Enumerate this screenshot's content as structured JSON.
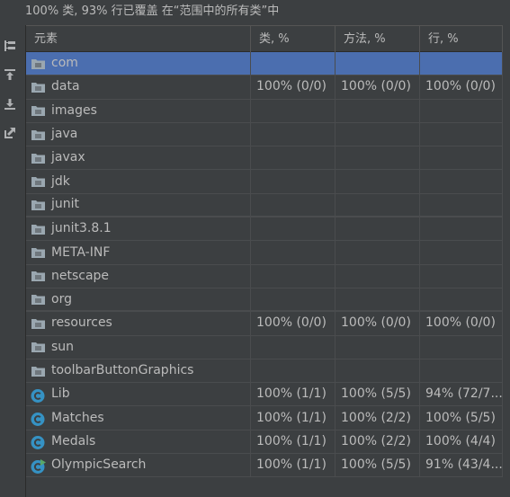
{
  "header": {
    "summary": "100% 类, 93% 行已覆盖 在“范围中的所有类”中"
  },
  "toolbar": {
    "buttons": [
      {
        "icon": "up-arrow-icon",
        "enabled": false
      },
      {
        "icon": "flatten-packages-icon",
        "enabled": true
      },
      {
        "icon": "import-icon",
        "enabled": true
      },
      {
        "icon": "export-icon",
        "enabled": true
      },
      {
        "icon": "generate-report-icon",
        "enabled": true
      }
    ]
  },
  "table": {
    "columns": [
      "元素",
      "类, %",
      "方法, %",
      "行, %"
    ],
    "rows": [
      {
        "icon": "package-icon",
        "name": "com",
        "cls": "",
        "method": "",
        "line": "",
        "selected": true
      },
      {
        "icon": "package-icon",
        "name": "data",
        "cls": "100% (0/0)",
        "method": "100% (0/0)",
        "line": "100% (0/0)"
      },
      {
        "icon": "package-icon",
        "name": "images",
        "cls": "",
        "method": "",
        "line": ""
      },
      {
        "icon": "package-icon",
        "name": "java",
        "cls": "",
        "method": "",
        "line": ""
      },
      {
        "icon": "package-icon",
        "name": "javax",
        "cls": "",
        "method": "",
        "line": ""
      },
      {
        "icon": "package-icon",
        "name": "jdk",
        "cls": "",
        "method": "",
        "line": ""
      },
      {
        "icon": "package-icon",
        "name": "junit",
        "cls": "",
        "method": "",
        "line": ""
      },
      {
        "icon": "package-icon",
        "name": "junit3.8.1",
        "cls": "",
        "method": "",
        "line": ""
      },
      {
        "icon": "package-icon",
        "name": "META-INF",
        "cls": "",
        "method": "",
        "line": ""
      },
      {
        "icon": "package-icon",
        "name": "netscape",
        "cls": "",
        "method": "",
        "line": ""
      },
      {
        "icon": "package-icon",
        "name": "org",
        "cls": "",
        "method": "",
        "line": ""
      },
      {
        "icon": "package-icon",
        "name": "resources",
        "cls": "100% (0/0)",
        "method": "100% (0/0)",
        "line": "100% (0/0)"
      },
      {
        "icon": "package-icon",
        "name": "sun",
        "cls": "",
        "method": "",
        "line": ""
      },
      {
        "icon": "package-icon",
        "name": "toolbarButtonGraphics",
        "cls": "",
        "method": "",
        "line": ""
      },
      {
        "icon": "class-icon",
        "name": "Lib",
        "cls": "100% (1/1)",
        "method": "100% (5/5)",
        "line": "94% (72/7..."
      },
      {
        "icon": "class-icon",
        "name": "Matches",
        "cls": "100% (1/1)",
        "method": "100% (2/2)",
        "line": "100% (5/5)"
      },
      {
        "icon": "class-icon",
        "name": "Medals",
        "cls": "100% (1/1)",
        "method": "100% (2/2)",
        "line": "100% (4/4)"
      },
      {
        "icon": "class-run-icon",
        "name": "OlympicSearch",
        "cls": "100% (1/1)",
        "method": "100% (5/5)",
        "line": "91% (43/4..."
      }
    ]
  },
  "colors": {
    "background": "#3c3f41",
    "selection": "#4b6eaf",
    "text": "#bbbbbb",
    "class_icon": "#3592c4",
    "run_badge": "#59a869"
  }
}
